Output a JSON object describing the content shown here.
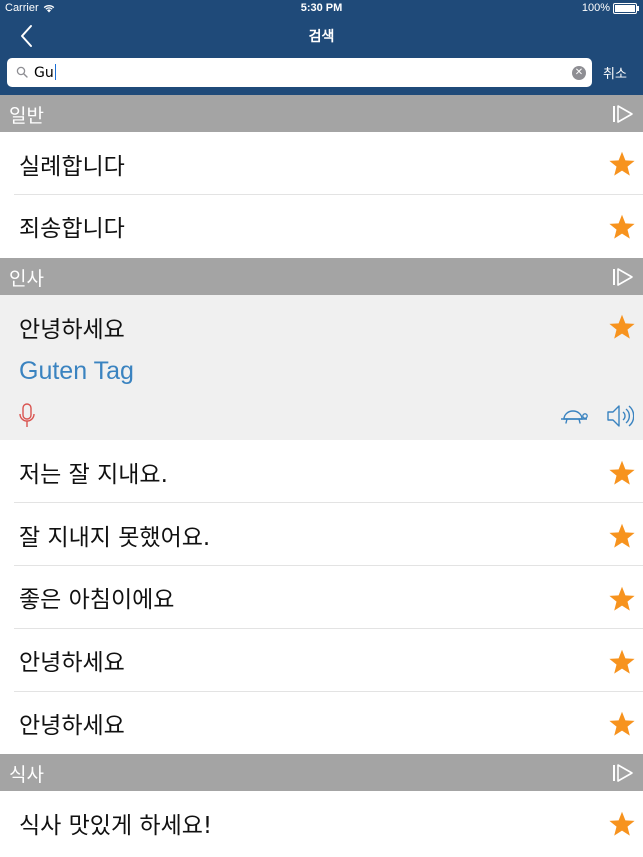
{
  "status": {
    "carrier": "Carrier",
    "time": "5:30 PM",
    "battery": "100%"
  },
  "nav": {
    "title": "검색"
  },
  "search": {
    "query": "Gu",
    "cancel_label": "취소"
  },
  "colors": {
    "brand": "#1f4a79",
    "section": "#a4a4a4",
    "star": "#f7931e",
    "translation": "#3a83c0",
    "mic": "#d9534f",
    "icon_blue": "#3a83c0"
  },
  "sections": [
    {
      "title": "일반",
      "rows": [
        "실례합니다",
        "죄송합니다"
      ]
    },
    {
      "title": "인사",
      "expanded": {
        "phrase": "안녕하세요",
        "translation": "Guten Tag"
      },
      "rows": [
        "저는 잘 지내요.",
        "잘 지내지 못했어요.",
        "좋은 아침이에요",
        "안녕하세요",
        "안녕하세요"
      ]
    },
    {
      "title": "식사",
      "rows": [
        "식사 맛있게 하세요!"
      ]
    }
  ]
}
